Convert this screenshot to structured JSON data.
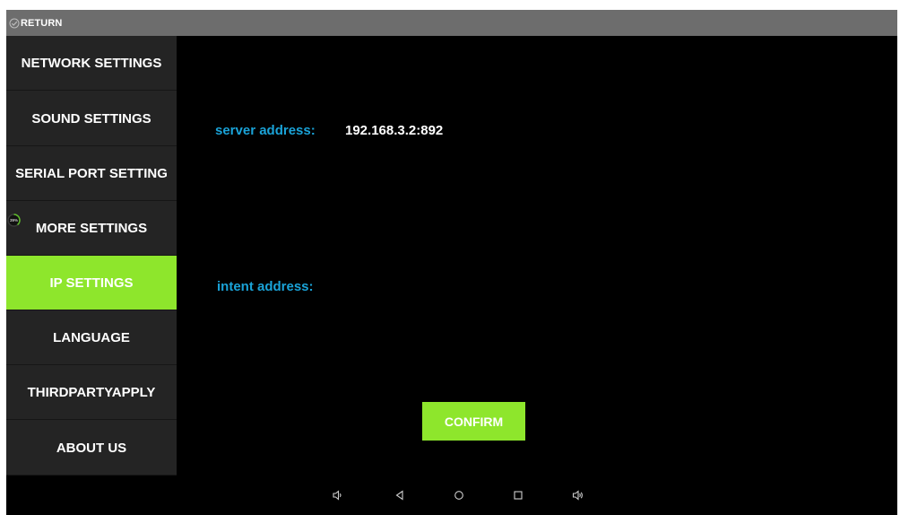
{
  "titlebar": {
    "return_label": "RETURN",
    "return_icon": "check-circle-icon"
  },
  "sidebar": {
    "items": [
      {
        "label": "NETWORK SETTINGS"
      },
      {
        "label": "SOUND SETTINGS"
      },
      {
        "label": "SERIAL PORT SETTING"
      },
      {
        "label": "MORE SETTINGS"
      },
      {
        "label": "IP SETTINGS",
        "active": true
      },
      {
        "label": "LANGUAGE"
      },
      {
        "label": "THIRDPARTYAPPLY"
      },
      {
        "label": "ABOUT US"
      }
    ],
    "progress_badge": {
      "text": "39%",
      "value": 0.39
    }
  },
  "main": {
    "server_label": "server address:",
    "server_value": "192.168.3.2:892",
    "intent_label": "intent address:",
    "intent_value": "",
    "confirm_label": "CONFIRM"
  },
  "navbar": {
    "icons": [
      "volume-down-icon",
      "back-icon",
      "home-icon",
      "recents-icon",
      "volume-up-icon"
    ]
  },
  "colors": {
    "accent": "#8ee62c",
    "label_blue": "#1aa3d8",
    "titlebar": "#6d6d6d",
    "sidebar": "#242424",
    "background": "#000000"
  }
}
